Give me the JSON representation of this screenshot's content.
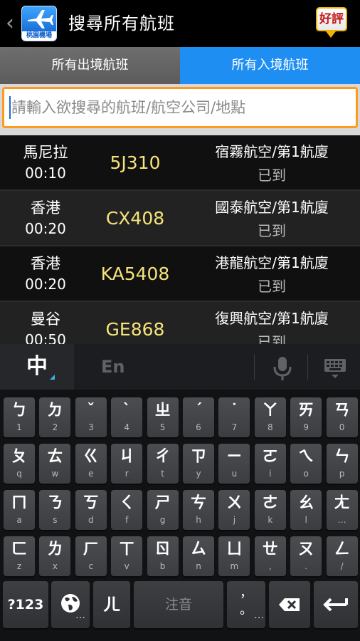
{
  "header": {
    "back_glyph": "‹",
    "app_icon_caption": "桃園機場",
    "title": "搜尋所有航班",
    "rate_label": "好評"
  },
  "tabs": [
    {
      "label": "所有出境航班",
      "active": false
    },
    {
      "label": "所有入境航班",
      "active": true
    }
  ],
  "search": {
    "placeholder": "請輸入欲搜尋的航班/航空公司/地點",
    "value": ""
  },
  "flights": [
    {
      "city": "馬尼拉",
      "time": "00:10",
      "flight": "5J310",
      "airline": "宿霧航空/第1航廈",
      "status": "已到"
    },
    {
      "city": "香港",
      "time": "00:20",
      "flight": "CX408",
      "airline": "國泰航空/第1航廈",
      "status": "已到"
    },
    {
      "city": "香港",
      "time": "00:20",
      "flight": "KA5408",
      "airline": "港龍航空/第1航廈",
      "status": "已到"
    },
    {
      "city": "曼谷",
      "time": "00:50",
      "flight": "GE868",
      "airline": "復興航空/第1航廈",
      "status": "已到"
    }
  ],
  "keyboard": {
    "mode_zh": "中",
    "mode_en": "En",
    "rows": [
      [
        {
          "m": "ㄅ",
          "s": "1"
        },
        {
          "m": "ㄉ",
          "s": "2"
        },
        {
          "m": "ˇ",
          "s": "3"
        },
        {
          "m": "ˋ",
          "s": "4"
        },
        {
          "m": "ㄓ",
          "s": "5"
        },
        {
          "m": "ˊ",
          "s": "6"
        },
        {
          "m": "˙",
          "s": "7"
        },
        {
          "m": "ㄚ",
          "s": "8"
        },
        {
          "m": "ㄞ",
          "s": "9"
        },
        {
          "m": "ㄢ",
          "s": "0"
        }
      ],
      [
        {
          "m": "ㄆ",
          "s": "q"
        },
        {
          "m": "ㄊ",
          "s": "w"
        },
        {
          "m": "ㄍ",
          "s": "e"
        },
        {
          "m": "ㄐ",
          "s": "r"
        },
        {
          "m": "ㄔ",
          "s": "t"
        },
        {
          "m": "ㄗ",
          "s": "y"
        },
        {
          "m": "ㄧ",
          "s": "u"
        },
        {
          "m": "ㄛ",
          "s": "i"
        },
        {
          "m": "ㄟ",
          "s": "o"
        },
        {
          "m": "ㄣ",
          "s": "p"
        }
      ],
      [
        {
          "m": "ㄇ",
          "s": "a"
        },
        {
          "m": "ㄋ",
          "s": "s"
        },
        {
          "m": "ㄎ",
          "s": "d"
        },
        {
          "m": "ㄑ",
          "s": "f"
        },
        {
          "m": "ㄕ",
          "s": "g"
        },
        {
          "m": "ㄘ",
          "s": "h"
        },
        {
          "m": "ㄨ",
          "s": "j"
        },
        {
          "m": "ㄜ",
          "s": "k"
        },
        {
          "m": "ㄠ",
          "s": "l"
        },
        {
          "m": "ㄤ",
          "s": "…"
        }
      ],
      [
        {
          "m": "ㄈ",
          "s": "z"
        },
        {
          "m": "ㄌ",
          "s": "x"
        },
        {
          "m": "ㄏ",
          "s": "c"
        },
        {
          "m": "ㄒ",
          "s": "v"
        },
        {
          "m": "ㄖ",
          "s": "b"
        },
        {
          "m": "ㄙ",
          "s": "n"
        },
        {
          "m": "ㄩ",
          "s": "m"
        },
        {
          "m": "ㄝ",
          "s": ","
        },
        {
          "m": "ㄡ",
          "s": "."
        },
        {
          "m": "ㄥ",
          "s": "/"
        }
      ]
    ],
    "symbols_label": "?123",
    "globe_sub": "…",
    "er_label": "ㄦ",
    "space_label": "注音",
    "punct_top": "，",
    "punct_bottom": "。",
    "punct_sub": "…"
  },
  "colors": {
    "tab_active": "#1e8ef3",
    "tab_inactive": "#656565",
    "search_border": "#ff9a1f",
    "flight_number": "#f6e37a",
    "accent_blue": "#35b5ea"
  }
}
